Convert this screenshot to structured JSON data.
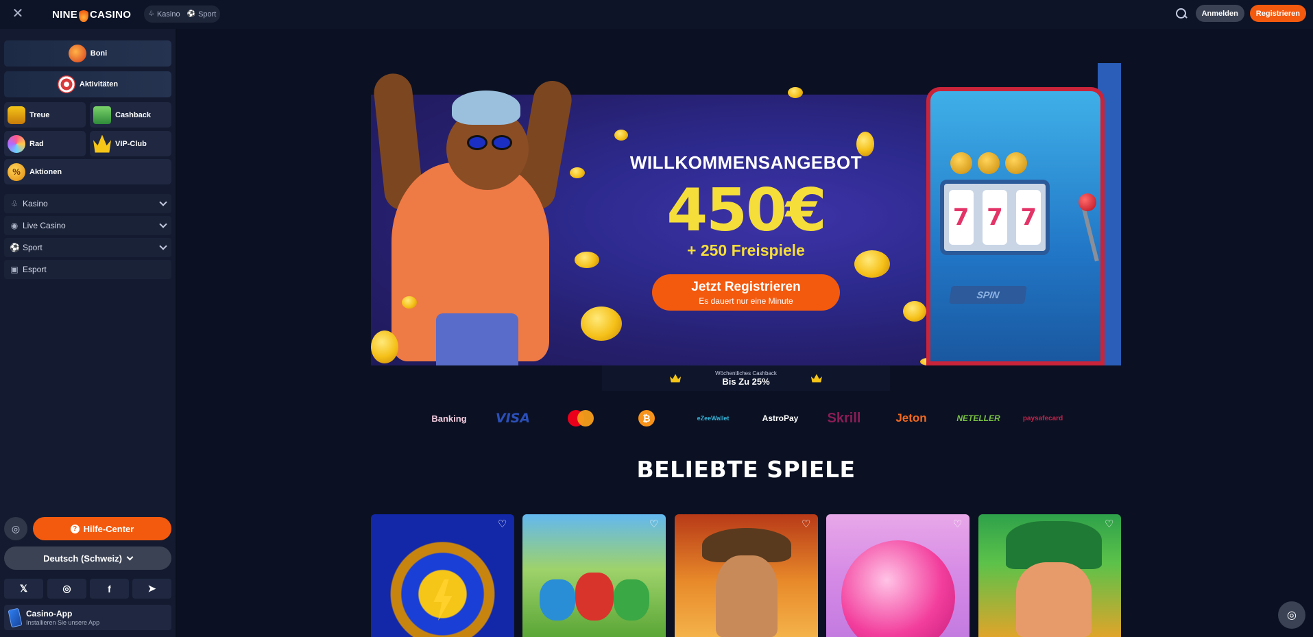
{
  "topbar": {
    "logo_left": "NINE",
    "logo_right": "CASINO",
    "tabs": [
      {
        "icon": "cherry-icon",
        "label": "Kasino"
      },
      {
        "icon": "soccer-ball-icon",
        "label": "Sport"
      }
    ],
    "login_label": "Anmelden",
    "register_label": "Registrieren"
  },
  "sidebar": {
    "wide_items": [
      {
        "label": "Boni",
        "icon": "gift-boxes-icon"
      },
      {
        "label": "Aktivitäten",
        "icon": "dart-target-icon"
      }
    ],
    "grid_items": [
      {
        "label": "Treue",
        "icon": "shield-badge-icon"
      },
      {
        "label": "Cashback",
        "icon": "money-stack-icon"
      },
      {
        "label": "Rad",
        "icon": "wheel-icon"
      },
      {
        "label": "VIP-Club",
        "icon": "crown-icon"
      },
      {
        "label": "Aktionen",
        "icon": "percent-coin-icon"
      }
    ],
    "nav": [
      {
        "label": "Kasino",
        "icon": "cherry-icon",
        "expandable": true
      },
      {
        "label": "Live Casino",
        "icon": "live-broadcast-icon",
        "expandable": true
      },
      {
        "label": "Sport",
        "icon": "soccer-ball-icon",
        "expandable": true
      },
      {
        "label": "Esport",
        "icon": "gamepad-icon",
        "expandable": false
      }
    ],
    "help_label": "Hilfe-Center",
    "language_label": "Deutsch (Schweiz)",
    "socials": [
      "x-icon",
      "instagram-icon",
      "facebook-icon",
      "telegram-icon"
    ],
    "app_title": "Casino-App",
    "app_subtitle": "Installieren Sie unsere App"
  },
  "banner": {
    "title": "WILLKOMMENSANGEBOT",
    "amount": "450€",
    "subtitle": "+ 250 Freispiele",
    "cta_label": "Jetzt Registrieren",
    "cta_sub": "Es dauert nur eine Minute",
    "slot_label": "SPIN",
    "reels": [
      "7",
      "7",
      "7"
    ]
  },
  "cashback": {
    "small": "Wöchentliches Cashback",
    "big": "Bis Zu 25%"
  },
  "payments": [
    "Banking",
    "VISA",
    "mastercard",
    "bitcoin",
    "eZeeWallet",
    "AstroPay",
    "Skrill",
    "Jeton",
    "NETELLER",
    "paysafecard"
  ],
  "popular": {
    "title": "BELIEBTE SPIELE",
    "games": [
      {
        "name": "lightning-diamond-game"
      },
      {
        "name": "rainbow-pots-game"
      },
      {
        "name": "explorer-adventure-game"
      },
      {
        "name": "candy-lollipop-game"
      },
      {
        "name": "leprechaun-gold-game"
      }
    ]
  },
  "colors": {
    "accent": "#f35a0e",
    "background": "#0b1123",
    "sidebar": "#141b30",
    "gold": "#f6de3a"
  }
}
